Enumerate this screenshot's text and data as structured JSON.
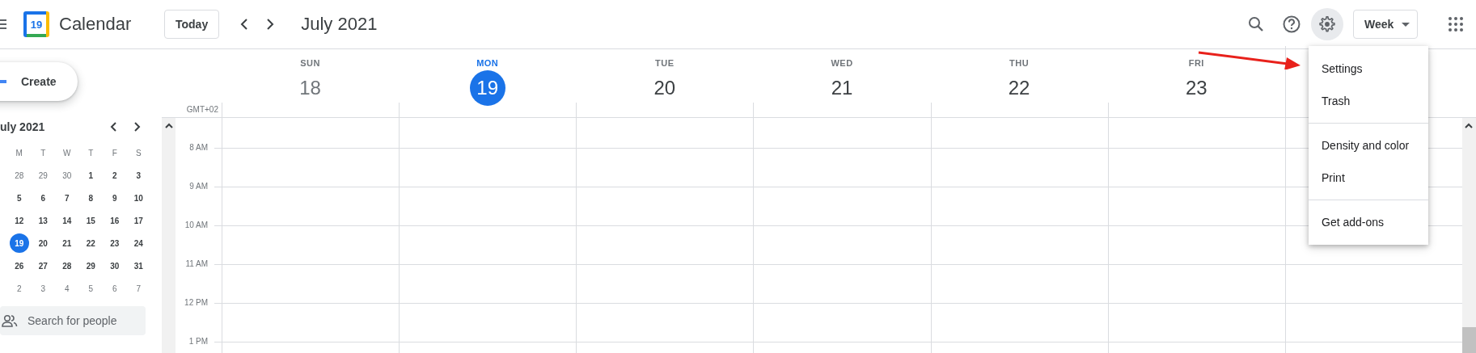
{
  "header": {
    "app_name": "Calendar",
    "logo_day": "19",
    "today_button": "Today",
    "period": "July 2021",
    "view_select": "Week",
    "toolbar_icons": [
      {
        "kind": "search",
        "active": false
      },
      {
        "kind": "help",
        "active": false
      },
      {
        "kind": "settings",
        "active": true
      }
    ]
  },
  "sidebar": {
    "create_button": "Create",
    "mini_calendar": {
      "month": "uly 2021",
      "weekdays": [
        "M",
        "T",
        "W",
        "T",
        "F",
        "S"
      ],
      "weeks": [
        [
          {
            "n": "28",
            "in_month": false,
            "selected": false
          },
          {
            "n": "29",
            "in_month": false,
            "selected": false
          },
          {
            "n": "30",
            "in_month": false,
            "selected": false
          },
          {
            "n": "1",
            "in_month": true,
            "selected": false
          },
          {
            "n": "2",
            "in_month": true,
            "selected": false
          },
          {
            "n": "3",
            "in_month": true,
            "selected": false
          }
        ],
        [
          {
            "n": "5",
            "in_month": true,
            "selected": false
          },
          {
            "n": "6",
            "in_month": true,
            "selected": false
          },
          {
            "n": "7",
            "in_month": true,
            "selected": false
          },
          {
            "n": "8",
            "in_month": true,
            "selected": false
          },
          {
            "n": "9",
            "in_month": true,
            "selected": false
          },
          {
            "n": "10",
            "in_month": true,
            "selected": false
          }
        ],
        [
          {
            "n": "12",
            "in_month": true,
            "selected": false
          },
          {
            "n": "13",
            "in_month": true,
            "selected": false
          },
          {
            "n": "14",
            "in_month": true,
            "selected": false
          },
          {
            "n": "15",
            "in_month": true,
            "selected": false
          },
          {
            "n": "16",
            "in_month": true,
            "selected": false
          },
          {
            "n": "17",
            "in_month": true,
            "selected": false
          }
        ],
        [
          {
            "n": "19",
            "in_month": true,
            "selected": true
          },
          {
            "n": "20",
            "in_month": true,
            "selected": false
          },
          {
            "n": "21",
            "in_month": true,
            "selected": false
          },
          {
            "n": "22",
            "in_month": true,
            "selected": false
          },
          {
            "n": "23",
            "in_month": true,
            "selected": false
          },
          {
            "n": "24",
            "in_month": true,
            "selected": false
          }
        ],
        [
          {
            "n": "26",
            "in_month": true,
            "selected": false
          },
          {
            "n": "27",
            "in_month": true,
            "selected": false
          },
          {
            "n": "28",
            "in_month": true,
            "selected": false
          },
          {
            "n": "29",
            "in_month": true,
            "selected": false
          },
          {
            "n": "30",
            "in_month": true,
            "selected": false
          },
          {
            "n": "31",
            "in_month": true,
            "selected": false
          }
        ],
        [
          {
            "n": "2",
            "in_month": false,
            "selected": false
          },
          {
            "n": "3",
            "in_month": false,
            "selected": false
          },
          {
            "n": "4",
            "in_month": false,
            "selected": false
          },
          {
            "n": "5",
            "in_month": false,
            "selected": false
          },
          {
            "n": "6",
            "in_month": false,
            "selected": false
          },
          {
            "n": "7",
            "in_month": false,
            "selected": false
          }
        ]
      ]
    },
    "people_search": {
      "placeholder": "Search for people"
    }
  },
  "week": {
    "timezone": "GMT+02",
    "days": [
      {
        "name": "SUN",
        "date": "18",
        "selected": false,
        "past": true
      },
      {
        "name": "MON",
        "date": "19",
        "selected": true,
        "past": false
      },
      {
        "name": "TUE",
        "date": "20",
        "selected": false,
        "past": false
      },
      {
        "name": "WED",
        "date": "21",
        "selected": false,
        "past": false
      },
      {
        "name": "THU",
        "date": "22",
        "selected": false,
        "past": false
      },
      {
        "name": "FRI",
        "date": "23",
        "selected": false,
        "past": false
      }
    ],
    "hours": [
      "8 AM",
      "9 AM",
      "10 AM",
      "11 AM",
      "12 PM",
      "1 PM"
    ]
  },
  "settings_menu": {
    "groups": [
      [
        "Settings",
        "Trash"
      ],
      [
        "Density and color",
        "Print"
      ],
      [
        "Get add-ons"
      ]
    ]
  }
}
